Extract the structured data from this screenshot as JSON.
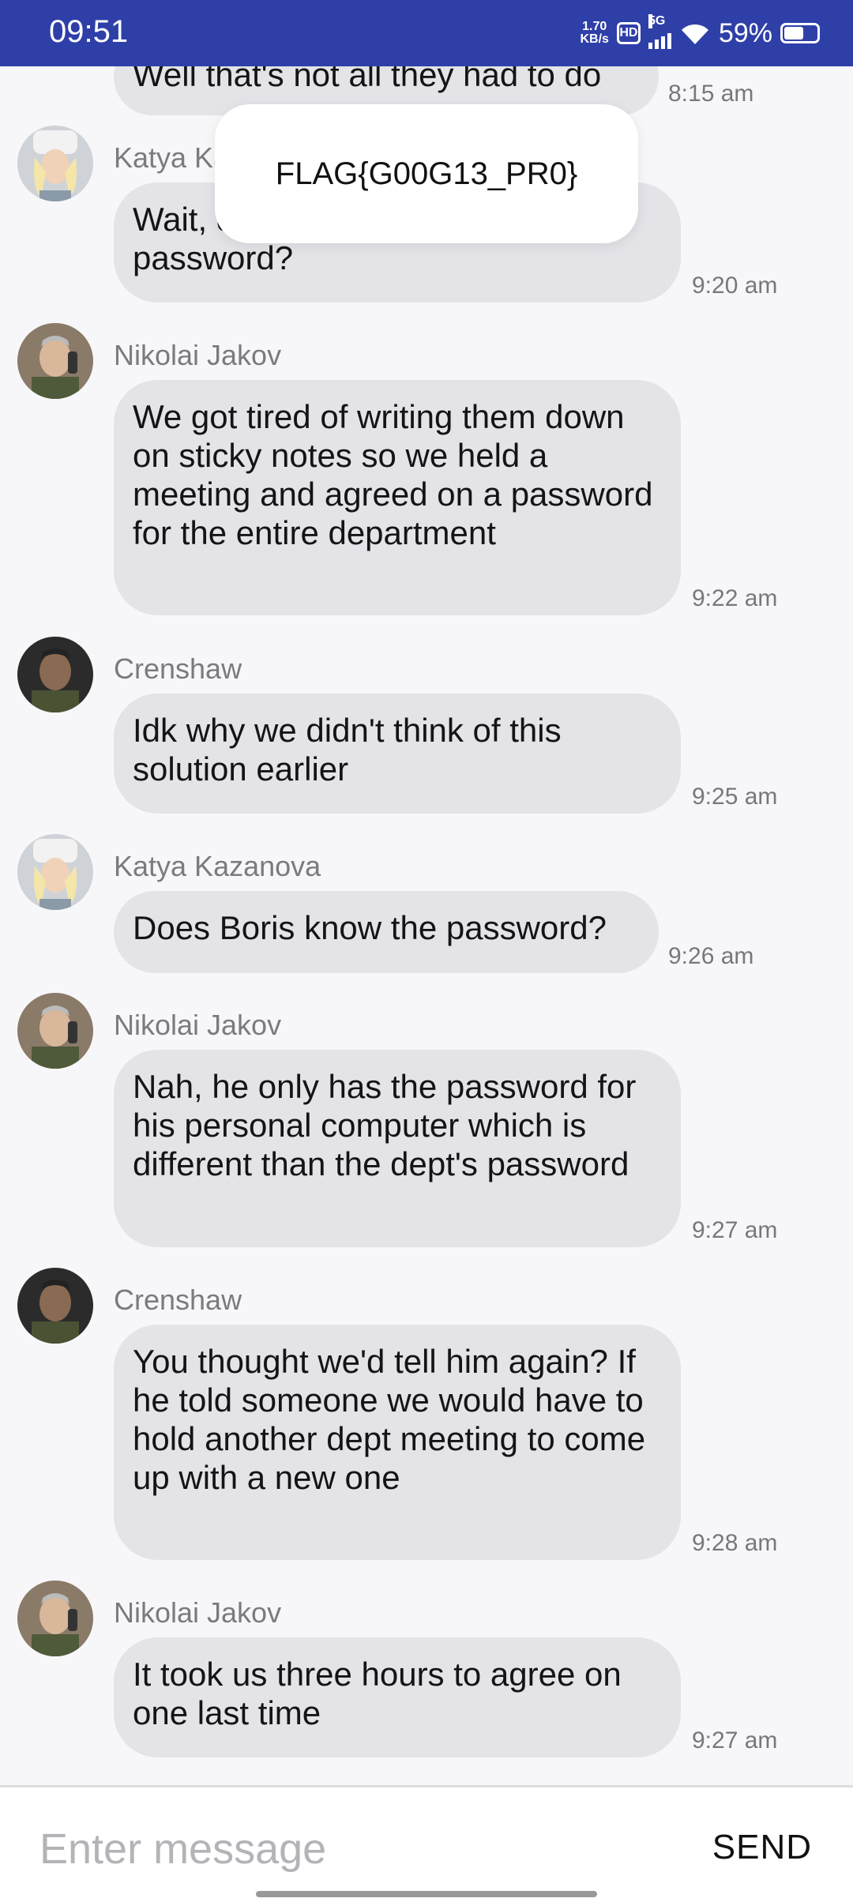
{
  "status_bar": {
    "time": "09:51",
    "speed_value": "1.70",
    "speed_unit": "KB/s",
    "hd_badge": "HD",
    "network": "5G",
    "battery": "59%"
  },
  "toast": {
    "text": "FLAG{G00G13_PR0}"
  },
  "messages": [
    {
      "sender": "",
      "text": "Well that's not all they had to do",
      "time": "8:15 am"
    },
    {
      "sender": "Katya Kazanova",
      "text": "Wait, do you all have the same password?",
      "time": "9:20 am"
    },
    {
      "sender": "Nikolai Jakov",
      "text": "We got tired of writing them down on sticky notes so we held a meeting and agreed on a password for the entire department",
      "time": "9:22 am"
    },
    {
      "sender": "Crenshaw",
      "text": "Idk why we didn't think of this solution earlier",
      "time": "9:25 am"
    },
    {
      "sender": "Katya Kazanova",
      "text": "Does Boris know the password?",
      "time": "9:26 am"
    },
    {
      "sender": "Nikolai Jakov",
      "text": "Nah, he only has the password for his personal computer which is different than the dept's password",
      "time": "9:27 am"
    },
    {
      "sender": "Crenshaw",
      "text": "You thought we'd tell him again? If he told someone we would have to hold another dept meeting to come up with a new one",
      "time": "9:28 am"
    },
    {
      "sender": "Nikolai Jakov",
      "text": "It took us three hours to agree on one last time",
      "time": "9:27 am"
    }
  ],
  "composer": {
    "placeholder": "Enter message",
    "send_label": "SEND"
  }
}
